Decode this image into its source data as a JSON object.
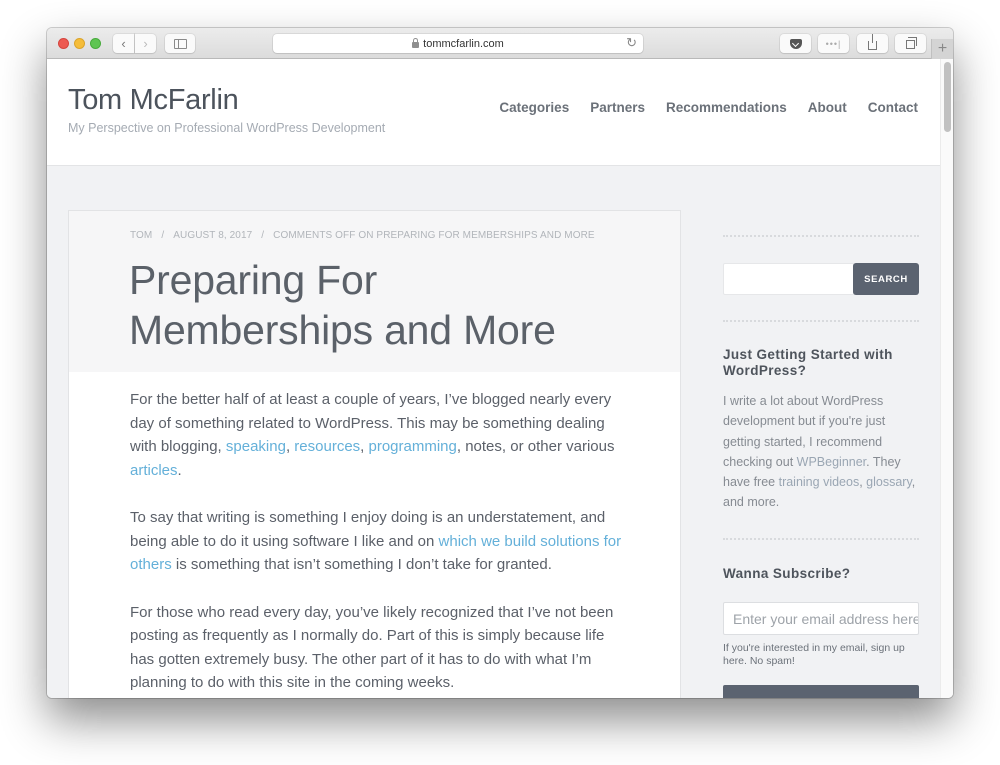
{
  "browser": {
    "url": "tommcfarlin.com",
    "icons": {
      "back": "chevron-left-icon",
      "forward": "chevron-right-icon",
      "sidebar": "sidebar-icon",
      "lock": "lock-icon",
      "reload": "reload-icon",
      "pocket": "pocket-icon",
      "more": "more-icon",
      "share": "share-icon",
      "tabs": "tabs-icon",
      "new_tab": "plus-icon"
    },
    "back_glyph": "‹",
    "forward_glyph": "›",
    "reload_glyph": "↻",
    "more_glyph": "•••|",
    "new_tab_glyph": "+"
  },
  "site": {
    "title": "Tom McFarlin",
    "tagline": "My Perspective on Professional WordPress Development",
    "nav": [
      {
        "label": "Categories"
      },
      {
        "label": "Partners"
      },
      {
        "label": "Recommendations"
      },
      {
        "label": "About"
      },
      {
        "label": "Contact"
      }
    ]
  },
  "post": {
    "meta": {
      "author": "TOM",
      "separator": "/",
      "date": "AUGUST 8, 2017",
      "comments": "COMMENTS OFF ON PREPARING FOR MEMBERSHIPS AND MORE"
    },
    "title_line1": "Preparing For",
    "title_line2": "Memberships and More",
    "paragraphs": [
      {
        "p1_a": "For the better half of at least a couple of years, I’ve blogged nearly every day of something related to WordPress. This may be something dealing with blogging, ",
        "link_speaking": "speaking",
        "p1_b": ", ",
        "link_resources": "resources",
        "p1_c": ", ",
        "link_programming": "programming",
        "p1_d": ", notes, or other various ",
        "link_articles": "articles",
        "p1_e": "."
      },
      {
        "p2_a": "To say that writing is something I enjoy doing is an understatement, and being able to do it using software I like and on ",
        "link_solutions": "which we build solutions for others",
        "p2_b": " is something that isn’t something I don’t take for granted."
      },
      {
        "p3": "For those who read every day, you’ve likely recognized that I’ve not been posting as frequently as I normally do. Part of this is simply because life has gotten extremely busy. The other part of it has to do with what I’m planning to do with this site in the coming weeks."
      }
    ]
  },
  "sidebar": {
    "search": {
      "value": "",
      "button_label": "SEARCH"
    },
    "getting_started": {
      "title": "Just Getting Started with WordPress?",
      "text_a": "I write a lot about WordPress development but if you're just getting started, I recommend checking out ",
      "link_wpbeginner": "WPBeginner",
      "text_b": ". They have free ",
      "link_training": "training videos",
      "text_c": ", ",
      "link_glossary": "glossary",
      "text_d": ", and more."
    },
    "subscribe": {
      "title": "Wanna Subscribe?",
      "email_placeholder": "Enter your email address here",
      "hint": "If you're interested in my email, sign up here. No spam!"
    }
  }
}
